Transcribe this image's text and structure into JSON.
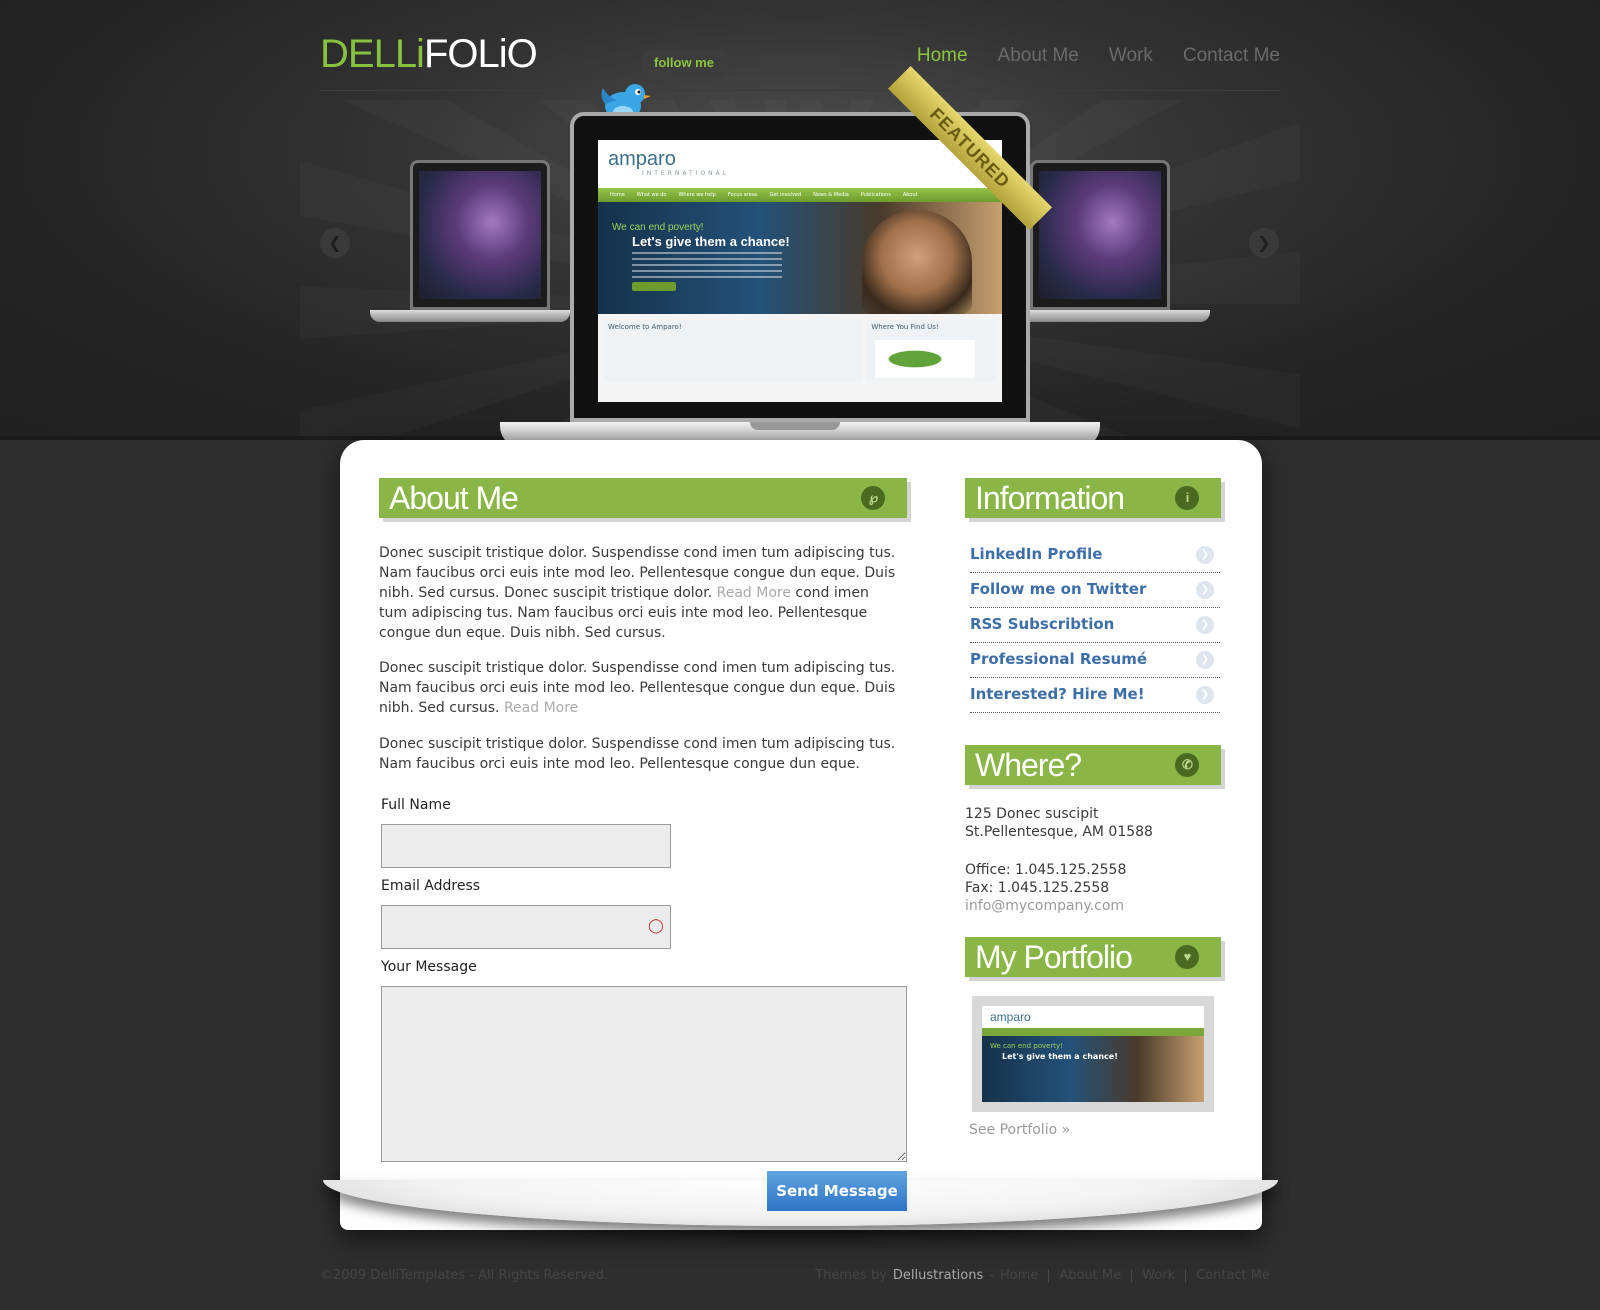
{
  "header": {
    "logo_part1": "DELLi",
    "logo_part2": "FOLiO",
    "follow_label": "follow me",
    "nav": [
      "Home",
      "About Me",
      "Work",
      "Contact Me"
    ]
  },
  "featured": {
    "ribbon": "FEATURED",
    "site_logo": "amparo",
    "site_logo_sub": "INTERNATIONAL",
    "site_nav": [
      "Home",
      "What we do",
      "Where we help",
      "Focus areas",
      "Get involved",
      "News & Media",
      "Publications",
      "About"
    ],
    "hero_line1": "We can end poverty!",
    "hero_line2": "Let's give them a chance!",
    "welcome": "Welcome to Amparo!",
    "where": "Where You Find Us!"
  },
  "about": {
    "title": "About Me",
    "p1_a": "Donec suscipit tristique dolor. Suspendisse cond imen tum adipiscing tus. Nam faucibus orci euis inte mod leo. Pellentesque congue dun eque. Duis nibh. Sed cursus. Donec suscipit tristique dolor. ",
    "p1_more": "Read More",
    "p1_b": " cond imen tum adipiscing tus. Nam faucibus orci euis inte mod leo. Pellentesque congue dun eque. Duis nibh. Sed cursus.",
    "p2_a": "Donec suscipit tristique dolor. Suspendisse cond imen tum adipiscing tus. Nam faucibus orci euis inte mod leo. Pellentesque congue dun eque. Duis nibh. Sed cursus. ",
    "p2_more": "Read More",
    "p3": "Donec suscipit tristique dolor. Suspendisse cond imen tum adipiscing tus. Nam faucibus orci euis inte mod leo. Pellentesque congue dun eque."
  },
  "form": {
    "name_label": "Full Name",
    "email_label": "Email Address",
    "message_label": "Your Message",
    "send_label": "Send Message"
  },
  "information": {
    "title": "Information",
    "links": [
      "LinkedIn Profile",
      "Follow me on Twitter",
      "RSS Subscribtion",
      "Professional Resumé",
      "Interested? Hire Me!"
    ]
  },
  "where": {
    "title": "Where?",
    "line1": "125 Donec suscipit",
    "line2": "St.Pellentesque, AM 01588",
    "office": "Office: 1.045.125.2558",
    "fax": "Fax: 1.045.125.2558",
    "email": "info@mycompany.com"
  },
  "portfolio": {
    "title": "My Portfolio",
    "see_link": "See Portfolio »"
  },
  "footer": {
    "copyright": "©2009 DelliTemplates - All Rights Reserved.",
    "themes_by": "Themes by",
    "brand": "Dellustrations",
    "dash": "-",
    "links": [
      "Home",
      "About Me",
      "Work",
      "Contact Me"
    ]
  },
  "colors": {
    "accent_green": "#8ab648",
    "link_blue": "#3e6ea8",
    "button_blue": "#2e74c4"
  }
}
